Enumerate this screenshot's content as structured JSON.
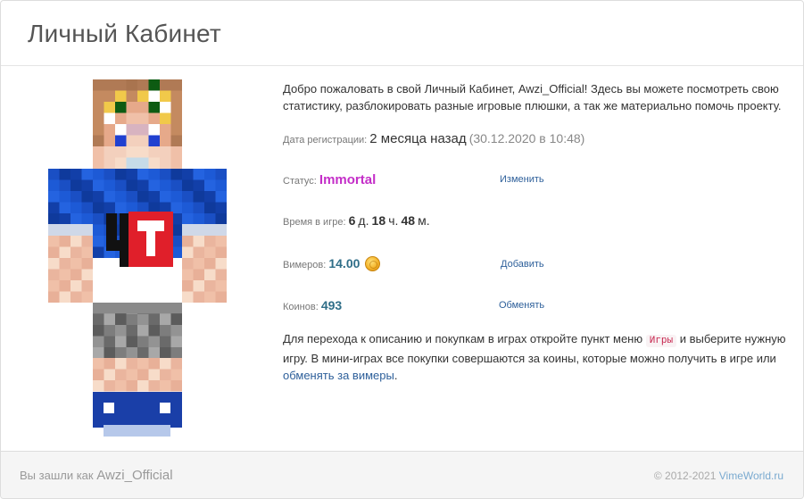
{
  "header": {
    "title": "Личный Кабинет"
  },
  "intro": {
    "text": "Добро пожаловать в свой Личный Кабинет, Awzi_Official! Здесь вы можете посмотреть свою статистику, разблокировать разные игровые плюшки, а так же материально помочь проекту."
  },
  "registration": {
    "label": "Дата регистрации:",
    "value": "2 месяца назад",
    "date": "(30.12.2020 в 10:48)"
  },
  "status": {
    "label": "Статус:",
    "value": "Immortal",
    "action": "Изменить"
  },
  "playtime": {
    "label": "Время в игре:",
    "days": "6",
    "days_unit": "д.",
    "hours": "18",
    "hours_unit": "ч.",
    "minutes": "48",
    "minutes_unit": "м."
  },
  "vimers": {
    "label": "Вимеров:",
    "value": "14.00",
    "action": "Добавить"
  },
  "coins": {
    "label": "Коинов:",
    "value": "493",
    "action": "Обменять"
  },
  "games_note": {
    "part1": "Для перехода к описанию и покупкам в играх откройте пункт меню ",
    "menu_item": "Игры",
    "part2": " и выберите нужную игру. В мини-играх все покупки совершаются за коины, которые можно получить в игре или ",
    "link": "обменять за вимеры",
    "part3": "."
  },
  "footer": {
    "logged_in_label": "Вы зашли как",
    "username": "Awzi_Official",
    "copyright": "© 2012-2021",
    "site": "VimeWorld.ru"
  },
  "colors": {
    "status_immortal": "#c42ec8",
    "link": "#2d5f9a",
    "currency": "#2f6e88"
  }
}
